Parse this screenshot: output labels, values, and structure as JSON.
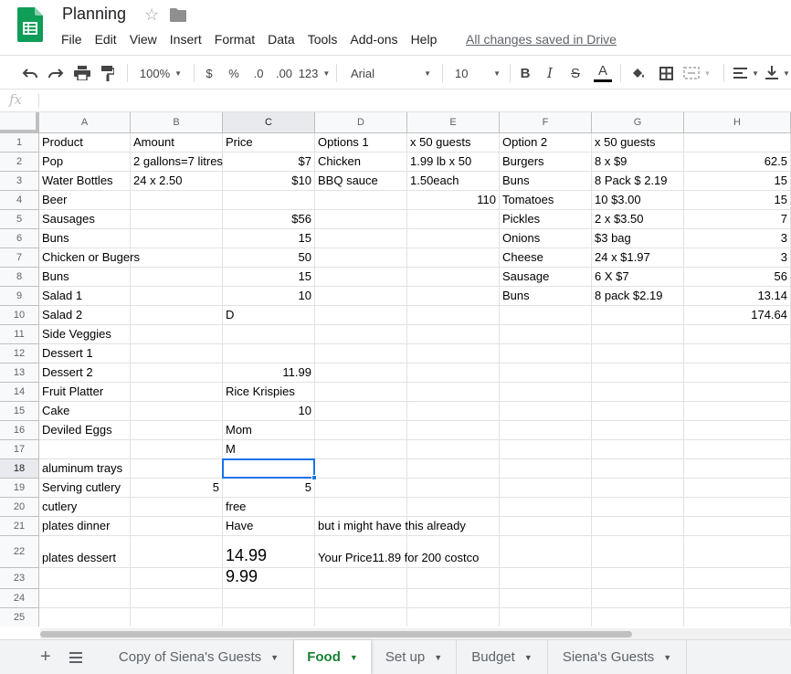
{
  "header": {
    "title": "Planning",
    "menu": [
      "File",
      "Edit",
      "View",
      "Insert",
      "Format",
      "Data",
      "Tools",
      "Add-ons",
      "Help"
    ],
    "save_status": "All changes saved in Drive"
  },
  "toolbar": {
    "zoom": "100%",
    "currency": "$",
    "percent": "%",
    "decrease_decimals": ".0",
    "increase_decimals": ".00",
    "more_formats": "123",
    "font": "Arial",
    "font_size": "10",
    "bold": "B",
    "italic": "I",
    "strikethrough": "S",
    "text_color": "A"
  },
  "formula_bar": {
    "label": "fx"
  },
  "grid": {
    "columns": [
      "A",
      "B",
      "C",
      "D",
      "E",
      "F",
      "G",
      "H"
    ],
    "rows": [
      "1",
      "2",
      "3",
      "4",
      "5",
      "6",
      "7",
      "8",
      "9",
      "10",
      "11",
      "12",
      "13",
      "14",
      "15",
      "16",
      "17",
      "18",
      "19",
      "20",
      "21",
      "22",
      "23",
      "24",
      "25"
    ],
    "selected_cell": "C18",
    "cells": {
      "A1": "Product",
      "B1": "Amount",
      "C1": "Price",
      "D1": "Options 1",
      "E1": "x 50 guests",
      "F1": "Option 2",
      "G1": "x 50 guests",
      "A2": "Pop",
      "B2": "2 gallons=7 litres",
      "C2": "$7",
      "D2": "Chicken",
      "E2": "1.99 lb x 50",
      "F2": "Burgers",
      "G2": "8 x $9",
      "H2": "62.5",
      "A3": "Water Bottles",
      "B3": "24 x 2.50",
      "C3": "$10",
      "D3": "BBQ sauce",
      "E3": "1.50each",
      "F3": "Buns",
      "G3": "8 Pack $ 2.19",
      "H3": "15",
      "A4": "Beer",
      "E4": "110",
      "F4": "Tomatoes",
      "G4": "10 $3.00",
      "H4": "15",
      "A5": "Sausages",
      "C5": "$56",
      "F5": "Pickles",
      "G5": "2 x $3.50",
      "H5": "7",
      "A6": "Buns",
      "C6": "15",
      "F6": "Onions",
      "G6": "$3 bag",
      "H6": "3",
      "A7": "Chicken or Bugers",
      "C7": "50",
      "F7": "Cheese",
      "G7": "24 x $1.97",
      "H7": "3",
      "A8": "Buns",
      "C8": "15",
      "F8": "Sausage",
      "G8": "6 X $7",
      "H8": "56",
      "A9": "Salad 1",
      "C9": "10",
      "F9": "Buns",
      "G9": "8 pack $2.19",
      "H9": "13.14",
      "A10": "Salad 2",
      "C10": "D",
      "H10": "174.64",
      "A11": "Side Veggies",
      "A12": "Dessert 1",
      "A13": "Dessert 2",
      "C13": "11.99",
      "A14": "Fruit Platter",
      "C14": "Rice Krispies",
      "A15": "Cake",
      "C15": "10",
      "A16": "Deviled Eggs",
      "C16": "Mom",
      "C17": "M",
      "A18": "aluminum trays",
      "A19": "Serving cutlery",
      "B19": "5",
      "C19": "5",
      "A20": "cutlery",
      "C20": "free",
      "A21": "plates dinner",
      "C21": "Have",
      "D21": "but i might have this already",
      "A22": "plates dessert",
      "C22": "14.99",
      "D22": "Your Price11.89 for 200 costco",
      "C23": "9.99"
    }
  },
  "sheets": {
    "tabs": [
      "Copy of Siena's Guests",
      "Food",
      "Set up",
      "Budget",
      "Siena's Guests"
    ],
    "active": "Food"
  },
  "colors": {
    "brand_green": "#188038",
    "selection_blue": "#1a73e8",
    "header_gray": "#f8f9fa"
  }
}
